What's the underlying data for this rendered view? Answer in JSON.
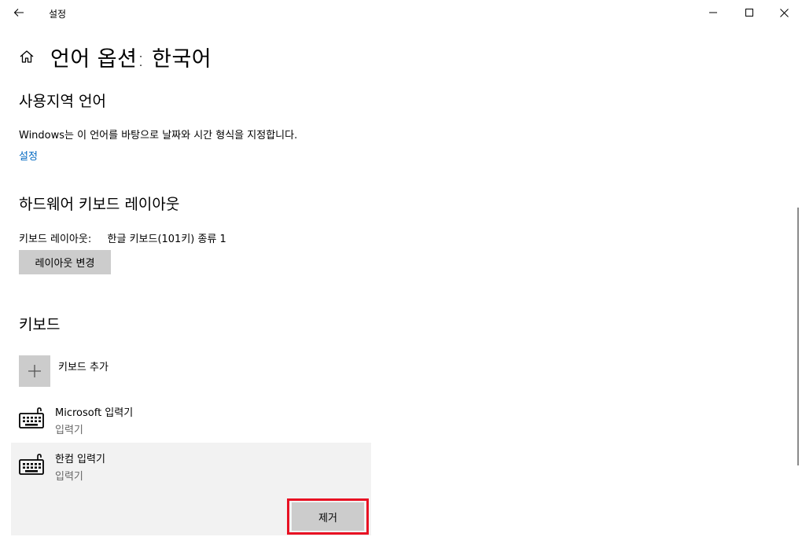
{
  "window": {
    "app_title": "설정"
  },
  "header": {
    "page_title": "언어 옵션: 한국어"
  },
  "regional": {
    "section_title": "사용지역 언어",
    "description": "Windows는 이 언어를 바탕으로 날짜와 시간 형식을 지정합니다.",
    "settings_link": "설정"
  },
  "hardware_keyboard": {
    "section_title": "하드웨어 키보드 레이아웃",
    "layout_label": "키보드 레이아웃:",
    "layout_value": "한글 키보드(101키) 종류 1",
    "change_button": "레이아웃 변경"
  },
  "keyboards": {
    "section_title": "키보드",
    "add_label": "키보드 추가",
    "items": [
      {
        "name": "Microsoft 입력기",
        "subtitle": "입력기",
        "selected": false
      },
      {
        "name": "한컴 입력기",
        "subtitle": "입력기",
        "selected": true
      }
    ],
    "remove_button": "제거"
  },
  "colors": {
    "accent_link": "#0067c0",
    "highlight": "#e81123",
    "button_bg": "#cccccc",
    "selected_bg": "#f2f2f2"
  },
  "icons": {
    "back": "back-arrow-icon",
    "home": "home-icon",
    "minimize": "minimize-icon",
    "maximize": "maximize-icon",
    "close": "close-icon",
    "add": "plus-icon",
    "keyboard": "keyboard-icon"
  }
}
